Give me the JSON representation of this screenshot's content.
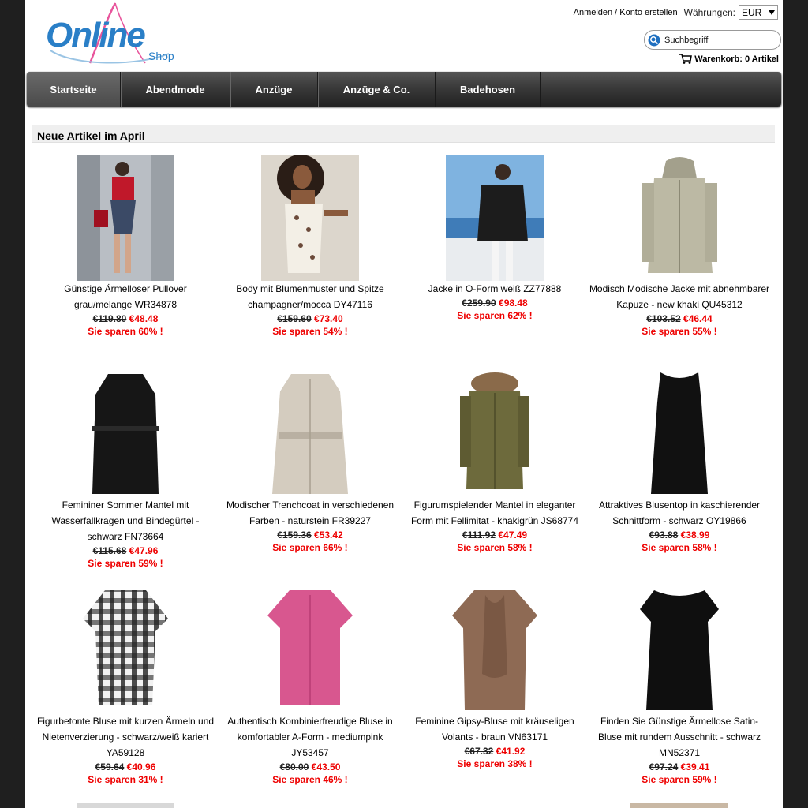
{
  "logo": {
    "text": "Online",
    "sub": "Shop"
  },
  "header": {
    "login": "Anmelden",
    "separator": "/",
    "register": "Konto erstellen",
    "currency_label": "Währungen:",
    "currency_value": "EUR",
    "search_placeholder": "Suchbegriff",
    "cart": "Warenkorb: 0 Artikel"
  },
  "nav": [
    {
      "label": "Startseite",
      "active": true
    },
    {
      "label": "Abendmode"
    },
    {
      "label": "Anzüge"
    },
    {
      "label": "Anzüge & Co."
    },
    {
      "label": "Badehosen"
    }
  ],
  "section_title": "Neue Artikel im April",
  "products": [
    {
      "name": "Günstige Ärmelloser Pullover grau/melange WR34878",
      "old": "€119.80",
      "new": "€48.48",
      "save": "Sie sparen 60% !"
    },
    {
      "name": "Body mit Blumenmuster und Spitze champagner/mocca DY47116",
      "old": "€159.60",
      "new": "€73.40",
      "save": "Sie sparen 54% !"
    },
    {
      "name": "Jacke in O-Form weiß ZZ77888",
      "old": "€259.90",
      "new": "€98.48",
      "save": "Sie sparen 62% !"
    },
    {
      "name": "Modisch Modische Jacke mit abnehmbarer Kapuze - new khaki QU45312",
      "old": "€103.52",
      "new": "€46.44",
      "save": "Sie sparen 55% !"
    },
    {
      "name": "Femininer Sommer Mantel mit Wasserfallkragen und Bindegürtel - schwarz FN73664",
      "old": "€115.68",
      "new": "€47.96",
      "save": "Sie sparen 59% !"
    },
    {
      "name": "Modischer Trenchcoat in verschiedenen Farben - naturstein FR39227",
      "old": "€159.36",
      "new": "€53.42",
      "save": "Sie sparen 66% !"
    },
    {
      "name": "Figurumspielender Mantel in eleganter Form mit Fellimitat - khakigrün JS68774",
      "old": "€111.92",
      "new": "€47.49",
      "save": "Sie sparen 58% !"
    },
    {
      "name": "Attraktives Blusentop in kaschierender Schnittform - schwarz OY19866",
      "old": "€93.88",
      "new": "€38.99",
      "save": "Sie sparen 58% !"
    },
    {
      "name": "Figurbetonte Bluse mit kurzen Ärmeln und Nietenverzierung - schwarz/weiß kariert YA59128",
      "old": "€59.64",
      "new": "€40.96",
      "save": "Sie sparen 31% !"
    },
    {
      "name": "Authentisch Kombinierfreudige Bluse in komfortabler A-Form - mediumpink JY53457",
      "old": "€80.00",
      "new": "€43.50",
      "save": "Sie sparen 46% !"
    },
    {
      "name": "Feminine Gipsy-Bluse mit kräuseligen Volants - braun VN63171",
      "old": "€67.32",
      "new": "€41.92",
      "save": "Sie sparen 38% !"
    },
    {
      "name": "Finden Sie Günstige Ärmellose Satin-Bluse mit rundem Ausschnitt - schwarz MN52371",
      "old": "€97.24",
      "new": "€39.41",
      "save": "Sie sparen 59% !"
    }
  ]
}
